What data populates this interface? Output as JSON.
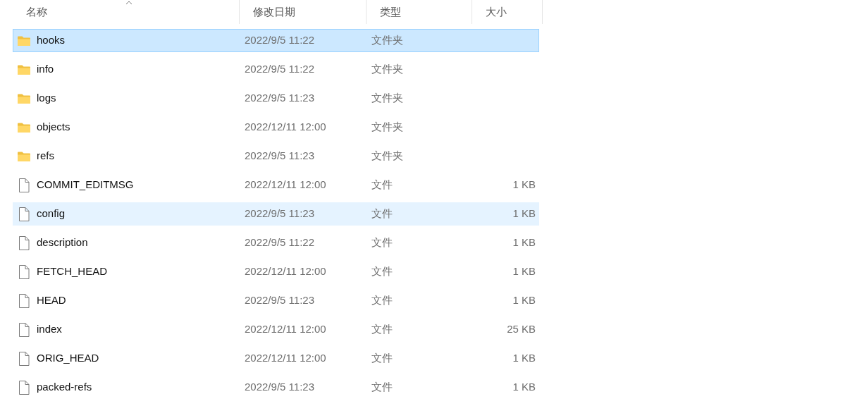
{
  "columns": [
    {
      "label": "名称",
      "sorted": true
    },
    {
      "label": "修改日期",
      "sorted": false
    },
    {
      "label": "类型",
      "sorted": false
    },
    {
      "label": "大小",
      "sorted": false
    }
  ],
  "rows": [
    {
      "kind": "folder",
      "name": "hooks",
      "date": "2022/9/5 11:22",
      "type": "文件夹",
      "selected": true,
      "hovered": false
    },
    {
      "kind": "folder",
      "name": "info",
      "date": "2022/9/5 11:22",
      "type": "文件夹",
      "selected": false,
      "hovered": false
    },
    {
      "kind": "folder",
      "name": "logs",
      "date": "2022/9/5 11:23",
      "type": "文件夹",
      "selected": false,
      "hovered": false
    },
    {
      "kind": "folder",
      "name": "objects",
      "date": "2022/12/11 12:00",
      "type": "文件夹",
      "selected": false,
      "hovered": false
    },
    {
      "kind": "folder",
      "name": "refs",
      "date": "2022/9/5 11:23",
      "type": "文件夹",
      "selected": false,
      "hovered": false
    },
    {
      "kind": "file",
      "name": "COMMIT_EDITMSG",
      "date": "2022/12/11 12:00",
      "type": "文件",
      "size": "1 KB",
      "selected": false,
      "hovered": false
    },
    {
      "kind": "file",
      "name": "config",
      "date": "2022/9/5 11:23",
      "type": "文件",
      "size": "1 KB",
      "selected": false,
      "hovered": true
    },
    {
      "kind": "file",
      "name": "description",
      "date": "2022/9/5 11:22",
      "type": "文件",
      "size": "1 KB",
      "selected": false,
      "hovered": false
    },
    {
      "kind": "file",
      "name": "FETCH_HEAD",
      "date": "2022/12/11 12:00",
      "type": "文件",
      "size": "1 KB",
      "selected": false,
      "hovered": false
    },
    {
      "kind": "file",
      "name": "HEAD",
      "date": "2022/9/5 11:23",
      "type": "文件",
      "size": "1 KB",
      "selected": false,
      "hovered": false
    },
    {
      "kind": "file",
      "name": "index",
      "date": "2022/12/11 12:00",
      "type": "文件",
      "size": "25 KB",
      "selected": false,
      "hovered": false
    },
    {
      "kind": "file",
      "name": "ORIG_HEAD",
      "date": "2022/12/11 12:00",
      "type": "文件",
      "size": "1 KB",
      "selected": false,
      "hovered": false
    },
    {
      "kind": "file",
      "name": "packed-refs",
      "date": "2022/9/5 11:23",
      "type": "文件",
      "size": "1 KB",
      "selected": false,
      "hovered": false
    }
  ]
}
